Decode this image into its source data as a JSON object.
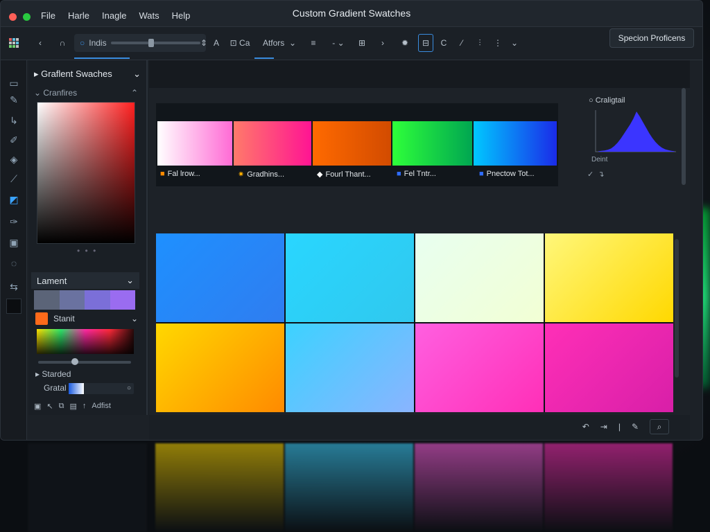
{
  "window": {
    "title": "Custom Gradient Swatches",
    "menu": [
      "File",
      "Harle",
      "Inagle",
      "Wats",
      "Help"
    ]
  },
  "toolbar": {
    "slider_label": "Indis",
    "text_tool": "A",
    "field_label": "Ca",
    "actions_label": "Atfors",
    "right_button": "Specion Proficens"
  },
  "left_panel": {
    "title": "Graflent Swaches",
    "subsection": "Cranfires",
    "lament_label": "Lament",
    "start_label": "Stanit",
    "standed_label": "Starded",
    "gratal_label": "Gratal",
    "foot_label": "Adfist"
  },
  "swatch_strip": {
    "items": [
      {
        "label": "Fal lrow...",
        "icon": "swatch-icon",
        "icon_color": "#ff8a00",
        "stops": [
          "#ffffff",
          "#ff6bd5"
        ]
      },
      {
        "label": "Gradhins...",
        "icon": "sun-icon",
        "icon_color": "#ffb000",
        "stops": [
          "#ff7a6a",
          "#ff1493"
        ]
      },
      {
        "label": "Fourl Thant...",
        "icon": "diamond-icon",
        "icon_color": "#ffffff",
        "stops": [
          "#ff6a00",
          "#d24b00"
        ]
      },
      {
        "label": "Fel Tntr...",
        "icon": "square-icon",
        "icon_color": "#2f6cff",
        "stops": [
          "#2eff3a",
          "#00a651"
        ]
      },
      {
        "label": "Pnectow Tot...",
        "icon": "square-icon",
        "icon_color": "#2f6cff",
        "stops": [
          "#00c8ff",
          "#1a2be8"
        ]
      }
    ]
  },
  "histogram": {
    "title": "Craligtail",
    "axis_label": "Deint",
    "color": "#3b35ff",
    "profile": [
      1,
      2,
      3,
      5,
      8,
      14,
      22,
      32,
      44,
      56,
      68,
      82,
      100,
      88,
      74,
      60,
      46,
      34,
      24,
      16,
      10,
      6,
      4,
      2,
      1
    ]
  },
  "swatch_grid": {
    "cells": [
      {
        "stops": [
          "#1e90ff",
          "#2f7df0"
        ]
      },
      {
        "stops": [
          "#29d6ff",
          "#30c8ee"
        ]
      },
      {
        "stops": [
          "#e8fff0",
          "#f2ffd4"
        ]
      },
      {
        "stops": [
          "#fff77a",
          "#ffd800"
        ]
      },
      {
        "stops": [
          "#ffd800",
          "#ff8a00"
        ]
      },
      {
        "stops": [
          "#3cd2ff",
          "#8ab4ff"
        ]
      },
      {
        "stops": [
          "#ff5fe0",
          "#ff2fb7"
        ]
      },
      {
        "stops": [
          "#ff2fb7",
          "#d81fa8"
        ]
      }
    ]
  },
  "lament_colors": [
    "#5b6478",
    "#6a72a0",
    "#7b6fd8",
    "#9a6cf0"
  ]
}
